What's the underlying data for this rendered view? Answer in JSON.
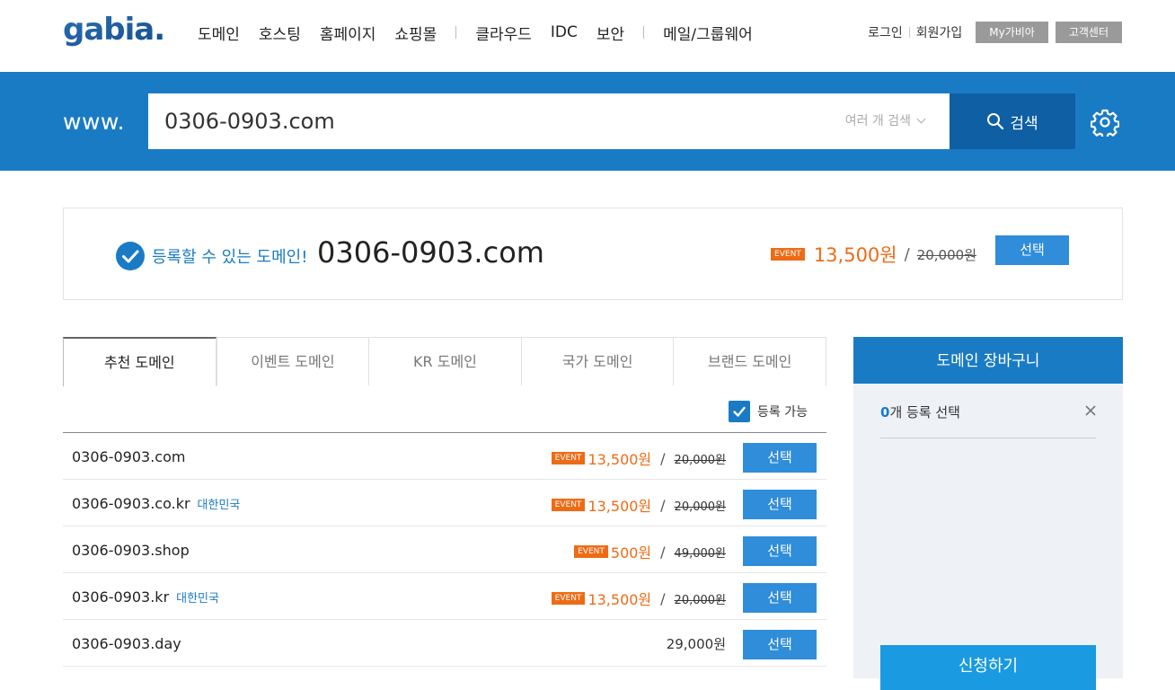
{
  "header": {
    "logo_text": "gabia.",
    "nav": [
      "도메인",
      "호스팅",
      "홈페이지",
      "쇼핑몰",
      "클라우드",
      "IDC",
      "보안",
      "메일/그룹웨어"
    ],
    "login": "로그인",
    "signup": "회원가입",
    "mygabia": "My가비아",
    "support": "고객센터"
  },
  "search": {
    "prefix": "www.",
    "query": "0306-0903.com",
    "multi_label": "여러 개 검색",
    "button_label": "검색"
  },
  "result": {
    "message": "등록할 수 있는 도메인!",
    "domain": "0306-0903.com",
    "badge": "EVENT",
    "sale_price": "13,500원",
    "original_price": "20,000원",
    "select_label": "선택"
  },
  "tabs": [
    "추천 도메인",
    "이벤트 도메인",
    "KR 도메인",
    "국가 도메인",
    "브랜드 도메인"
  ],
  "filter": {
    "label": "등록 가능"
  },
  "rows": [
    {
      "name": "0306-0903.com",
      "tag": "",
      "badge": "EVENT",
      "sale": "13,500원",
      "original": "20,000원",
      "price": "",
      "select": "선택"
    },
    {
      "name": "0306-0903.co.kr",
      "tag": "대한민국",
      "badge": "EVENT",
      "sale": "13,500원",
      "original": "20,000원",
      "price": "",
      "select": "선택"
    },
    {
      "name": "0306-0903.shop",
      "tag": "",
      "badge": "EVENT",
      "sale": "500원",
      "original": "49,000원",
      "price": "",
      "select": "선택"
    },
    {
      "name": "0306-0903.kr",
      "tag": "대한민국",
      "badge": "EVENT",
      "sale": "13,500원",
      "original": "20,000원",
      "price": "",
      "select": "선택"
    },
    {
      "name": "0306-0903.day",
      "tag": "",
      "badge": "",
      "sale": "",
      "original": "",
      "price": "29,000원",
      "select": "선택"
    }
  ],
  "cart": {
    "title": "도메인 장바구니",
    "count": "0",
    "count_suffix": "개 등록 선택",
    "apply_label": "신청하기"
  },
  "colors": {
    "brand_blue": "#1a7bc5",
    "dark_blue": "#0f5fa4",
    "event_orange": "#ee6b16"
  }
}
